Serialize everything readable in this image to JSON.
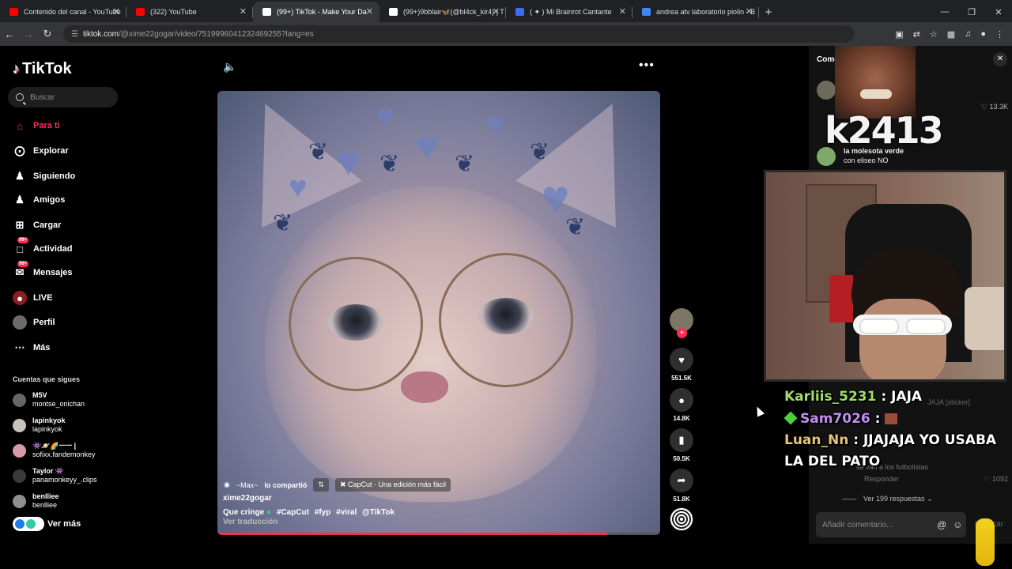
{
  "browser": {
    "tabs": [
      {
        "title": "Contenido del canal - YouTube",
        "color": "#ff0000",
        "active": false
      },
      {
        "title": "(322) YouTube",
        "color": "#ff0000",
        "active": false
      },
      {
        "title": "(99+) TikTok - Make Your Da",
        "color": "#ffffff",
        "active": true
      },
      {
        "title": "(99+)9bblair🦋(@bl4ck_kir4) | T",
        "color": "#ffffff",
        "active": false
      },
      {
        "title": "( ✦ ) Mi Brainrot Cantante",
        "color": "#3b6df5",
        "active": false
      },
      {
        "title": "andrea atv laboratorio piolin - B",
        "color": "#4285f4",
        "active": false
      }
    ],
    "url_host": "tiktok.com",
    "url_path": "/@xime22gogar/video/7519996041232469255?lang=es"
  },
  "sidebar": {
    "logo": "TikTok",
    "search_placeholder": "Buscar",
    "nav": [
      {
        "label": "Para ti",
        "icon": "home-icon",
        "active": true
      },
      {
        "label": "Explorar",
        "icon": "compass-icon"
      },
      {
        "label": "Siguiendo",
        "icon": "following-icon"
      },
      {
        "label": "Amigos",
        "icon": "friends-icon"
      },
      {
        "label": "Cargar",
        "icon": "upload-icon"
      },
      {
        "label": "Actividad",
        "icon": "activity-icon",
        "badge": "99+"
      },
      {
        "label": "Mensajes",
        "icon": "messages-icon",
        "badge": "99+"
      },
      {
        "label": "LIVE",
        "icon": "live-icon"
      },
      {
        "label": "Perfil",
        "icon": "profile-icon"
      },
      {
        "label": "Más",
        "icon": "more-icon"
      }
    ],
    "following_title": "Cuentas que sigues",
    "accounts": [
      {
        "name": "M5V",
        "handle": "montse_onichan"
      },
      {
        "name": "lapinkyok",
        "handle": "lapinkyok"
      },
      {
        "name": "👾🪐🌈ㅡㅡ |",
        "handle": "sofixx.fandemonkey"
      },
      {
        "name": "Taylor 👾",
        "handle": "panamonkeyy_.clips"
      },
      {
        "name": "benlliee",
        "handle": "benlliee"
      }
    ],
    "see_more": "Ver más"
  },
  "video": {
    "shared_by": "~Max~",
    "shared_label": "lo compartió",
    "capcut": "CapCut · Una edición más fácil",
    "author": "xime22gogar",
    "description": "Que cringe",
    "hashtags": [
      "#CapCut",
      "#fyp",
      "#viral",
      "@TikTok"
    ],
    "translate": "Ver traducción",
    "progress": 0.88
  },
  "actions": {
    "likes": "551.5K",
    "comments": "14.8K",
    "saves": "50.5K",
    "shares": "51.8K"
  },
  "comments_panel": {
    "title": "Come",
    "top_likes": "13.3K",
    "comment2_user": "la molesota verde",
    "comment2_text": "con eliseo NO",
    "sticker_text": "JAJA [sticker]",
    "reply_text": "se van a los futbolistas",
    "reply_label": "Responder",
    "reply_likes": "1092",
    "view_replies": "Ver 199 respuestas",
    "input_placeholder": "Añadir comentario...",
    "publish": "Publicar"
  },
  "overlay": {
    "channel_tag": "k2413",
    "chat": [
      {
        "user": "Karliis_5231",
        "user_color": "#9fdc6a",
        "message": "JAJA"
      },
      {
        "user": "Sam7026",
        "user_color": "#c48cf0",
        "message": ""
      },
      {
        "user": "Luan_Nn",
        "user_color": "#e7c47a",
        "message": "JJAJAJA YO USABA LA DEL PATO"
      }
    ]
  }
}
